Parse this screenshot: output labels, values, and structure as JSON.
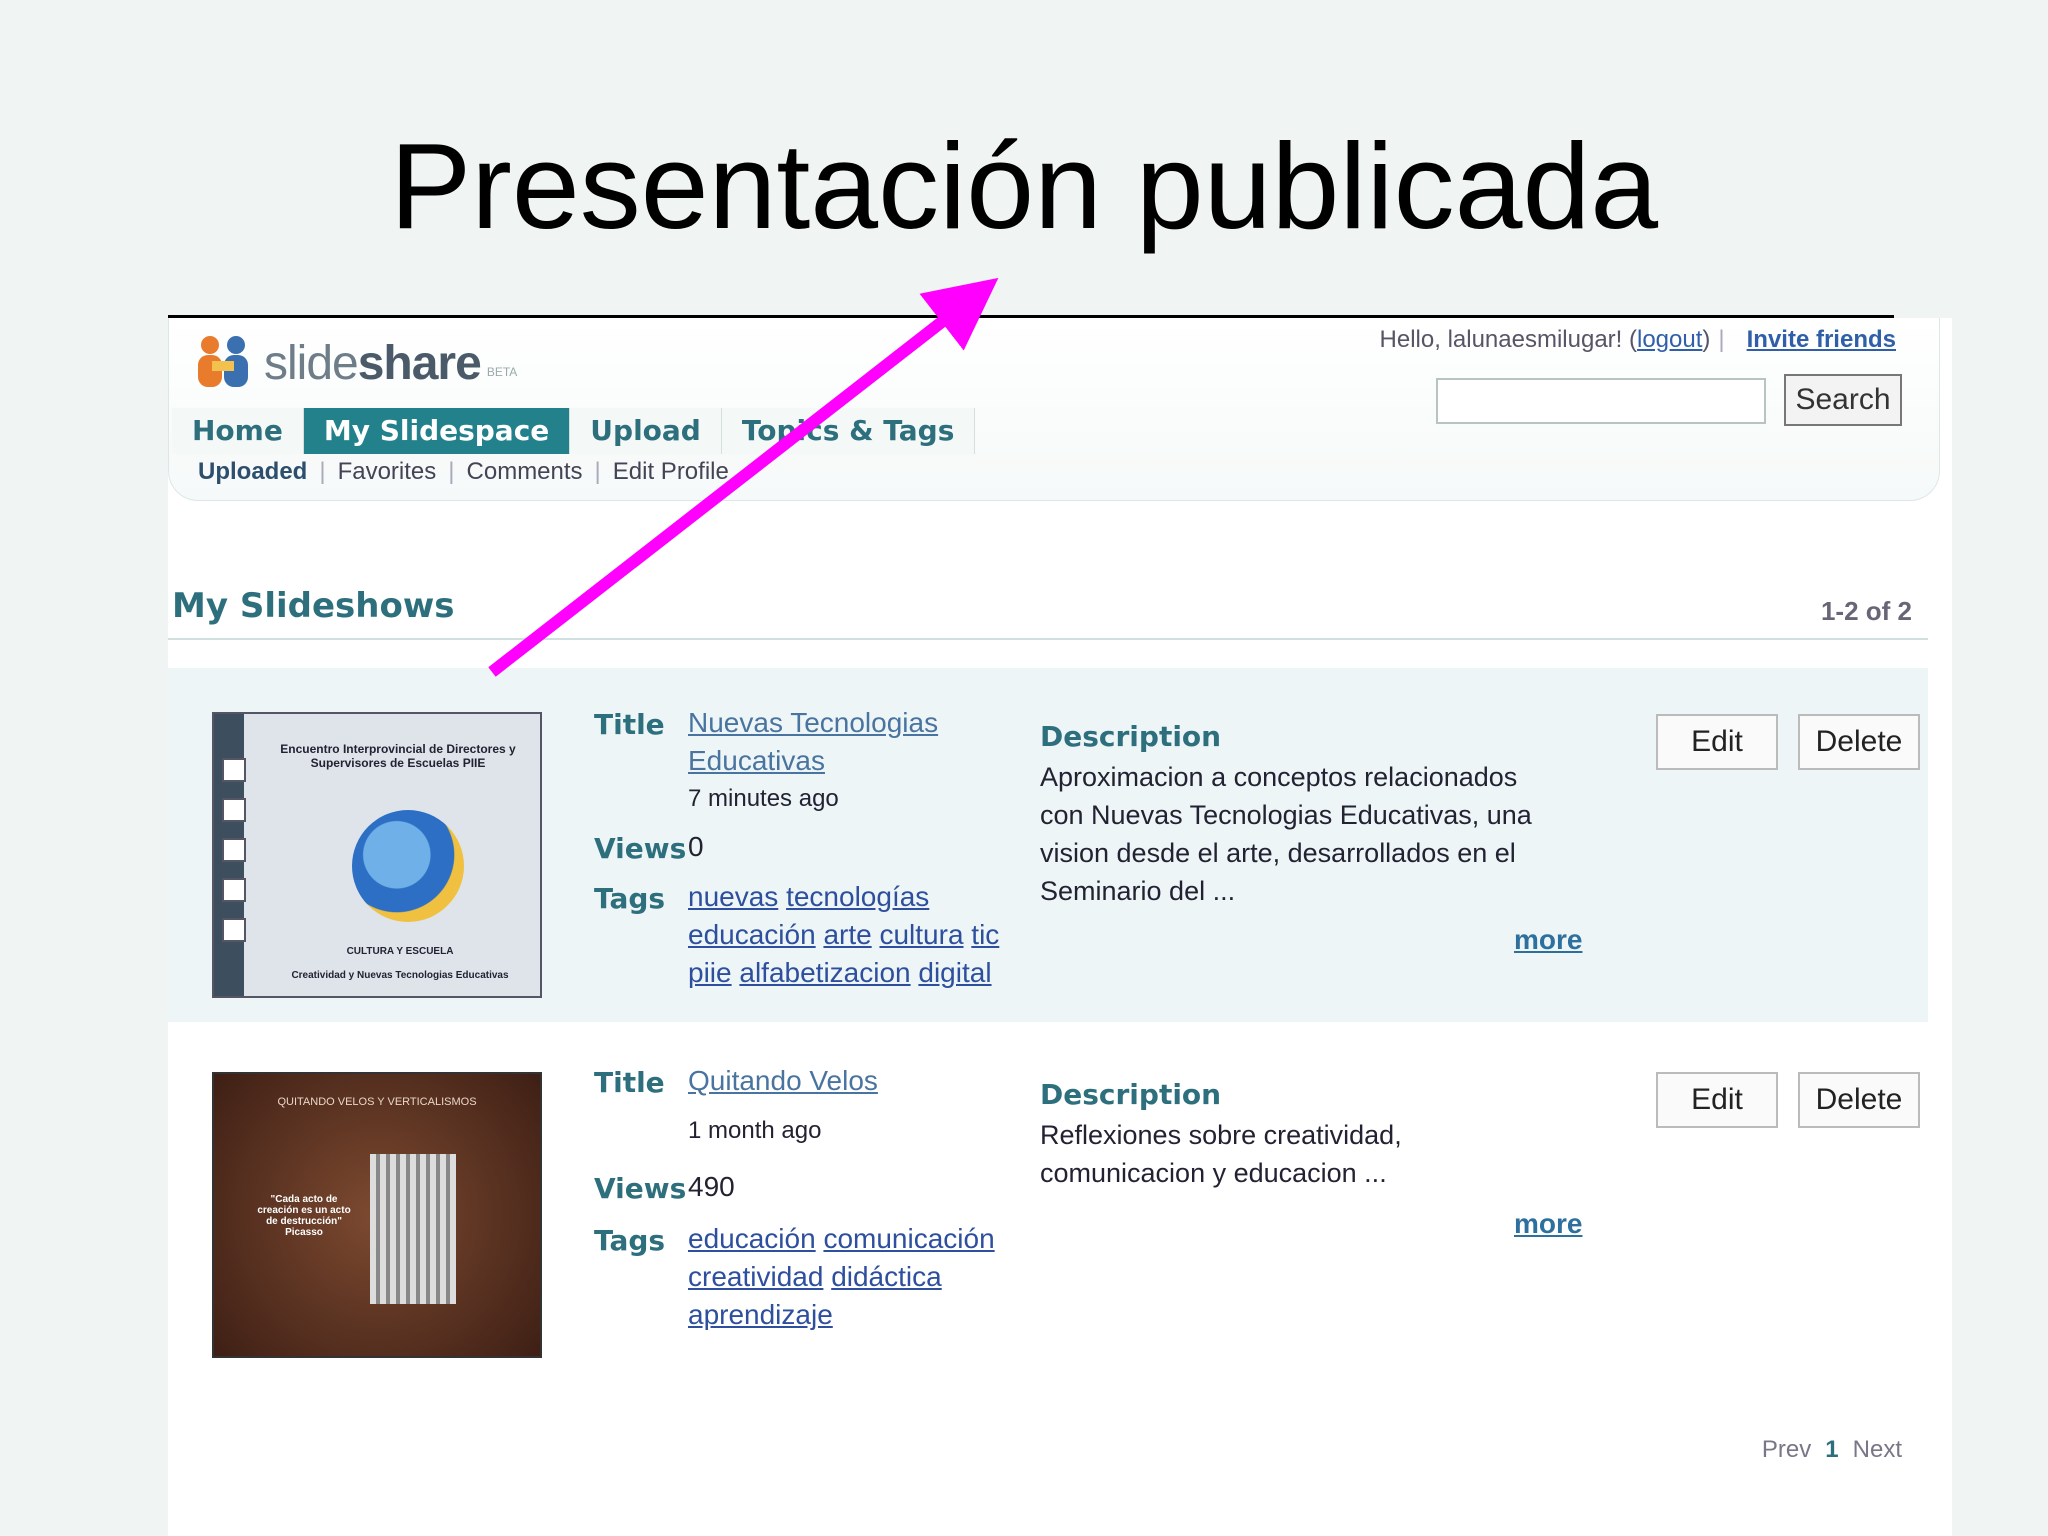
{
  "slide_title": "Presentación publicada",
  "header": {
    "logo_text_light": "slide",
    "logo_text_bold": "share",
    "logo_badge": "BETA",
    "hello_text": "Hello, lalunaesmilugar! (",
    "logout_label": "logout",
    "hello_close": ")",
    "invite_label": "Invite friends",
    "search_placeholder": "",
    "search_button": "Search"
  },
  "tabs": [
    {
      "label": "Home"
    },
    {
      "label": "My Slidespace",
      "active": true
    },
    {
      "label": "Upload"
    },
    {
      "label": "Topics & Tags"
    }
  ],
  "subnav": [
    "Uploaded",
    "Favorites",
    "Comments",
    "Edit Profile"
  ],
  "section": {
    "title": "My Slideshows",
    "count": "1-2 of 2"
  },
  "labels": {
    "title": "Title",
    "views": "Views",
    "tags": "Tags",
    "description": "Description",
    "more": "more",
    "edit": "Edit",
    "delete": "Delete"
  },
  "slideshows": [
    {
      "title_line1": "Nuevas Tecnologias",
      "title_line2": "Educativas",
      "time": "7 minutes ago",
      "views": "0",
      "tags": [
        "nuevas",
        "tecnologías",
        "educación",
        "arte",
        "cultura",
        "tic",
        "piie",
        "alfabetizacion",
        "digital"
      ],
      "description": "Aproximacion a conceptos relacionados con Nuevas Tecnologias Educativas, una vision desde el arte, desarrollados en el Seminario del ...",
      "thumb_caption": "Encuentro Interprovincial de Directores y Supervisores de Escuelas PIIE",
      "thumb_footer": "CULTURA Y ESCUELA",
      "thumb_footer2": "Creatividad y Nuevas Tecnologias Educativas"
    },
    {
      "title_line1": "Quitando Velos",
      "time": "1 month ago",
      "views": "490",
      "tags": [
        "educación",
        "comunicación",
        "creatividad",
        "didáctica",
        "aprendizaje"
      ],
      "description": "Reflexiones sobre creatividad, comunicacion y educacion ...",
      "thumb_caption": "QUITANDO VELOS Y VERTICALISMOS",
      "thumb_quote": "\"Cada acto de creación es un acto de destrucción\" Picasso"
    }
  ],
  "pager": {
    "prev": "Prev",
    "current": "1",
    "next": "Next"
  },
  "colors": {
    "accent": "#23818c",
    "arrow": "#ff00ff",
    "link": "#2d4f9d"
  }
}
